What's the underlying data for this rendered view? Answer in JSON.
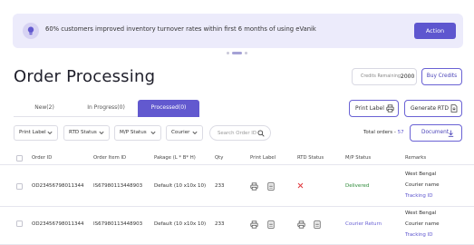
{
  "banner": {
    "text": "60% customers improved inventory turnover rates within first 6 months of using eVanik",
    "action_label": "Action"
  },
  "page": {
    "title": "Order Processing",
    "credits_label": "Credits Remaining:",
    "credits_value": "2000",
    "buy_credits_label": "Buy Credits"
  },
  "tabs": [
    {
      "label": "New(2)",
      "active": false
    },
    {
      "label": "In Progress(0)",
      "active": false
    },
    {
      "label": "Processed(0)",
      "active": true
    }
  ],
  "actions": {
    "print_label": "Print Label",
    "generate_rtd": "Generate RTD"
  },
  "filters": [
    {
      "label": "Print Label"
    },
    {
      "label": "RTD Status"
    },
    {
      "label": "M/P Status"
    },
    {
      "label": "Courier"
    }
  ],
  "search": {
    "placeholder": "Search Order ID",
    "value": ""
  },
  "summary": {
    "total_label": "Total orders -",
    "total_value": "57"
  },
  "document_label": "Document",
  "table": {
    "columns": [
      "Order ID",
      "Order Item ID",
      "Pakage (L * B* H)",
      "Qty",
      "Print Label",
      "RTD Status",
      "M/P Status",
      "Remarks"
    ],
    "rows": [
      {
        "order_id": "OD23456798011344",
        "order_item_id": "IS67980113448903",
        "package": "Default (10 x10x 10)",
        "qty": "233",
        "rtd_status": "cross",
        "mp_status": "Delivered",
        "remark_state": "West Bengal",
        "remark_courier": "Courier name",
        "remark_tracking": "Tracking ID"
      },
      {
        "order_id": "OD23456798011344",
        "order_item_id": "IS67980113448903",
        "package": "Default (10 x10x 10)",
        "qty": "233",
        "rtd_status": "icons",
        "mp_status": "Courier Return",
        "remark_state": "West Bengal",
        "remark_courier": "Courier name",
        "remark_tracking": "Tracking ID"
      }
    ]
  },
  "colors": {
    "accent": "#5e56cf",
    "banner_bg": "#ecebfb",
    "delivered": "#2e8b3a",
    "cross": "#e0393e"
  },
  "icons": [
    "bulb-icon",
    "printer-icon",
    "document-icon",
    "download-icon",
    "search-icon",
    "chevron-down-icon",
    "cross-icon"
  ]
}
